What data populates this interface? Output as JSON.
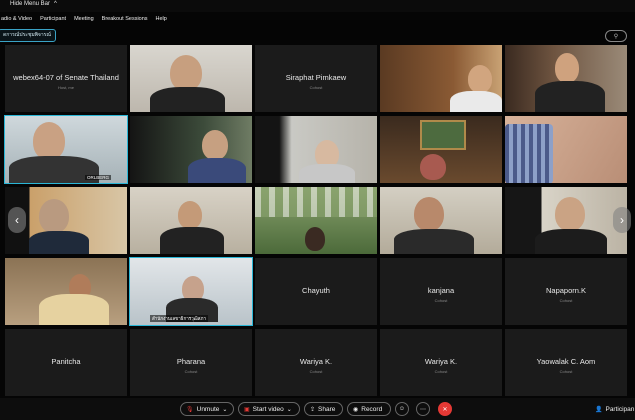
{
  "top": {
    "hide_menu_bar": "Hide Menu Bar",
    "chevron": "^"
  },
  "menu": [
    "adio & Video",
    "Participant",
    "Meeting",
    "Breakout Sessions",
    "Help"
  ],
  "meeting_title": "ดการณ์ประชุมพิจารณ์",
  "tiles": [
    {
      "name": "webex64-07 of Senate Thailand",
      "sub": "Host, me",
      "kind": "text"
    },
    {
      "kind": "video"
    },
    {
      "name": "Siraphat Pimkaew",
      "sub": "Cohost",
      "kind": "text"
    },
    {
      "kind": "video"
    },
    {
      "kind": "video"
    },
    {
      "kind": "video",
      "caption": "ORLBERG"
    },
    {
      "kind": "video"
    },
    {
      "kind": "video"
    },
    {
      "kind": "video"
    },
    {
      "kind": "video"
    },
    {
      "kind": "video"
    },
    {
      "kind": "video"
    },
    {
      "kind": "video"
    },
    {
      "kind": "video"
    },
    {
      "kind": "video"
    },
    {
      "kind": "video"
    },
    {
      "kind": "video",
      "caption": "สำนักงานเลขาธิการวุฒิสภา"
    },
    {
      "name": "Chayuth",
      "sub": "",
      "kind": "text"
    },
    {
      "name": "kanjana",
      "sub": "Cohost",
      "kind": "text"
    },
    {
      "name": "Napaporn.K",
      "sub": "Cohost",
      "kind": "text"
    },
    {
      "name": "Panitcha",
      "sub": "",
      "kind": "text"
    },
    {
      "name": "Pharana",
      "sub": "Cohost",
      "kind": "text"
    },
    {
      "name": "Wariya K.",
      "sub": "Cohost",
      "kind": "text"
    },
    {
      "name": "Wariya K.",
      "sub": "Cohost",
      "kind": "text"
    },
    {
      "name": "Yaowalak C. Aom",
      "sub": "Cohost",
      "kind": "text"
    }
  ],
  "controls": {
    "unmute": "Unmute",
    "start_video": "Start video",
    "share": "Share",
    "record": "Record",
    "participants": "Participan"
  },
  "colors": {
    "accent": "#2ab6d6",
    "end": "#e53935"
  }
}
